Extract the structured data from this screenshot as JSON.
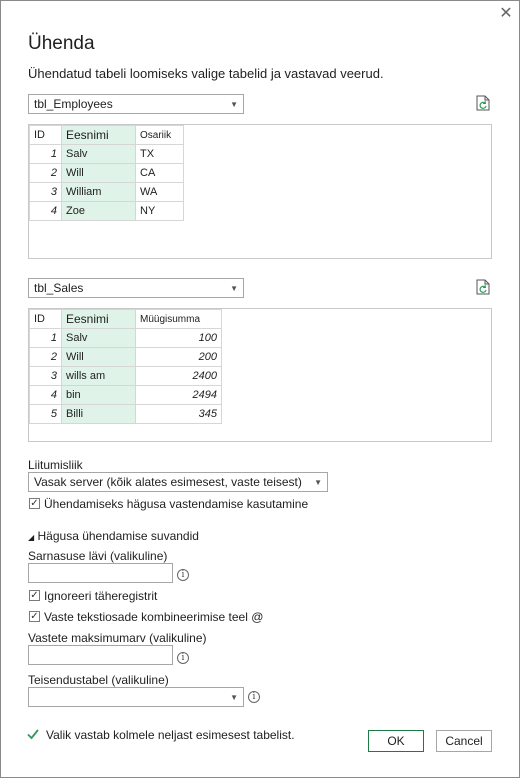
{
  "dialog": {
    "close_glyph": "✕",
    "title": "Ühenda",
    "subtitle": "Ühendatud tabeli loomiseks valige tabelid ja vastavad veerud."
  },
  "first_table": {
    "selected": "tbl_Employees",
    "headers": [
      "ID",
      "Eesnimi",
      "Osariik"
    ],
    "rows": [
      [
        "1",
        "Salv",
        "TX"
      ],
      [
        "2",
        "Will",
        "CA"
      ],
      [
        "3",
        "William",
        "WA"
      ],
      [
        "4",
        "Zoe",
        "NY"
      ]
    ]
  },
  "second_table": {
    "selected": "tbl_Sales",
    "headers": [
      "ID",
      "Eesnimi",
      "Müügisumma"
    ],
    "rows": [
      [
        "1",
        "Salv",
        "100"
      ],
      [
        "2",
        "Will",
        "200"
      ],
      [
        "3",
        "wills am",
        "2400"
      ],
      [
        "4",
        "bin",
        "2494"
      ],
      [
        "5",
        "Billi",
        "345"
      ]
    ]
  },
  "join": {
    "label": "Liitumisliik",
    "selected": "Vasak server (kõik alates esimesest, vaste teisest)",
    "fuzzy_checkbox_label": "Ühendamiseks hägusa vastendamise kasutamine"
  },
  "fuzzy_options": {
    "section_label": "Hägusa ühendamise suvandid",
    "similarity_label": "Sarnasuse lävi (valikuline)",
    "ignore_case_label": "Ignoreeri täheregistrit",
    "combine_text_label": "Vaste tekstiosade kombineerimise teel @",
    "max_matches_label": "Vastete maksimumarv (valikuline)",
    "transform_table_label": "Teisendustabel (valikuline)"
  },
  "status": {
    "message": "Valik vastab kolmele neljast esimesest tabelist."
  },
  "buttons": {
    "ok": "OK",
    "cancel": "Cancel"
  },
  "colors": {
    "selected_column": "#dff3e8",
    "success_check": "#2e9a5a",
    "ok_border": "#1d7a46"
  }
}
